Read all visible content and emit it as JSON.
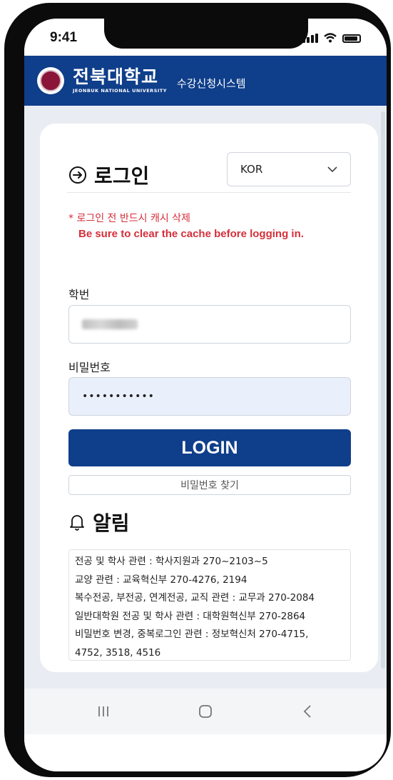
{
  "status_bar": {
    "time": "9:41"
  },
  "header": {
    "university_ko": "전북대학교",
    "university_en": "JEONBUK NATIONAL UNIVERSITY",
    "system_name": "수강신청시스템",
    "brand_color": "#0f3e8a"
  },
  "login": {
    "title": "로그인",
    "language": {
      "selected": "KOR"
    },
    "warning_ko": "* 로그인 전 반드시 캐시 삭제",
    "warning_en": "Be sure to clear the cache before logging in.",
    "student_id_label": "학번",
    "password_label": "비밀번호",
    "password_value": "•••••••••••",
    "login_button": "LOGIN",
    "find_password_button": "비밀번호 찾기"
  },
  "notice": {
    "title": "알림",
    "lines": [
      "전공 및 학사 관련 : 학사지원과 270~2103~5",
      "교양 관련 : 교육혁신부 270-4276, 2194",
      "복수전공, 부전공, 연계전공, 교직 관련 : 교무과 270-2084",
      "일반대학원 전공 및 학사 관련 : 대학원혁신부 270-2864",
      "비밀번호 변경, 중복로그인 관련 : 정보혁신처 270-4715,",
      "4752, 3518, 4516"
    ]
  },
  "icons": {
    "login": "login-arrow-icon",
    "language_dropdown": "chevron-down-icon",
    "notice": "bell-icon",
    "nav_recent": "recent-apps-icon",
    "nav_home": "home-icon",
    "nav_back": "back-icon"
  }
}
